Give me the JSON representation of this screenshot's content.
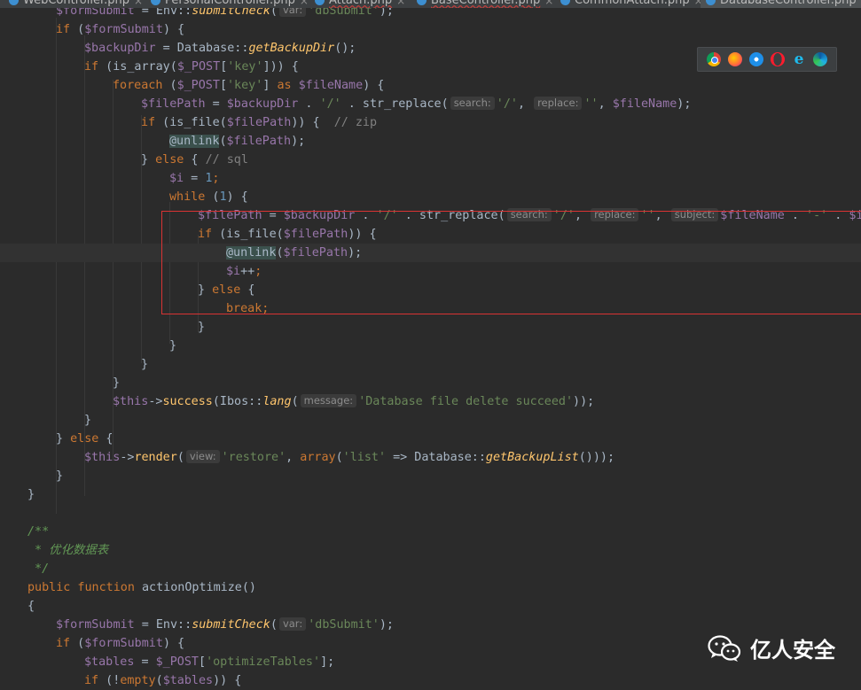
{
  "tabs": [
    {
      "label": "WebController.php"
    },
    {
      "label": "PersonalController.php"
    },
    {
      "label": "Attach.php"
    },
    {
      "label": "BaseController.php"
    },
    {
      "label": "CommonAttach.php"
    },
    {
      "label": "DatabaseController.php"
    }
  ],
  "browser_icons": [
    "chrome-icon",
    "firefox-icon",
    "safari-icon",
    "opera-icon",
    "ie-icon",
    "edge-icon"
  ],
  "colors": {
    "keyword": "#cc7832",
    "variable": "#9876aa",
    "string": "#6a8759",
    "function": "#ffc66d",
    "number": "#6897bb",
    "highlight_box": "#d93333"
  },
  "watermark": {
    "text": "亿人安全"
  },
  "code_lines": [
    {
      "indent": 1,
      "parts": [
        [
          "var",
          "$formSubmit"
        ],
        [
          "p",
          " = Env::"
        ],
        [
          "sfn",
          "submitCheck"
        ],
        [
          "p",
          "("
        ],
        [
          "hint",
          "var:"
        ],
        [
          "str",
          "'dbSubmit'"
        ],
        [
          "p",
          ");"
        ]
      ]
    },
    {
      "indent": 1,
      "parts": [
        [
          "kw",
          "if"
        ],
        [
          "p",
          " ("
        ],
        [
          "var",
          "$formSubmit"
        ],
        [
          "p",
          ") {"
        ]
      ]
    },
    {
      "indent": 2,
      "parts": [
        [
          "var",
          "$backupDir"
        ],
        [
          "p",
          " = Database::"
        ],
        [
          "sfn",
          "getBackupDir"
        ],
        [
          "p",
          "();"
        ]
      ]
    },
    {
      "indent": 2,
      "parts": [
        [
          "kw",
          "if"
        ],
        [
          "p",
          " (is_array("
        ],
        [
          "var",
          "$_POST"
        ],
        [
          "p",
          "["
        ],
        [
          "str",
          "'key'"
        ],
        [
          "p",
          "])) {"
        ]
      ]
    },
    {
      "indent": 3,
      "parts": [
        [
          "kw",
          "foreach"
        ],
        [
          "p",
          " ("
        ],
        [
          "var",
          "$_POST"
        ],
        [
          "p",
          "["
        ],
        [
          "str",
          "'key'"
        ],
        [
          "p",
          "] "
        ],
        [
          "kw",
          "as"
        ],
        [
          "p",
          " "
        ],
        [
          "var",
          "$fileName"
        ],
        [
          "p",
          ") {"
        ]
      ]
    },
    {
      "indent": 4,
      "parts": [
        [
          "var",
          "$filePath"
        ],
        [
          "p",
          " = "
        ],
        [
          "var",
          "$backupDir"
        ],
        [
          "p",
          " . "
        ],
        [
          "str",
          "'/'"
        ],
        [
          "p",
          " . str_replace("
        ],
        [
          "hint",
          "search:"
        ],
        [
          "str",
          "'/'"
        ],
        [
          "p",
          ", "
        ],
        [
          "hint",
          "replace:"
        ],
        [
          "str",
          "''"
        ],
        [
          "p",
          ", "
        ],
        [
          "var",
          "$fileName"
        ],
        [
          "p",
          ");"
        ]
      ]
    },
    {
      "indent": 4,
      "parts": [
        [
          "kw",
          "if"
        ],
        [
          "p",
          " (is_file("
        ],
        [
          "var",
          "$filePath"
        ],
        [
          "p",
          ")) {  "
        ],
        [
          "cmt",
          "// zip"
        ]
      ]
    },
    {
      "indent": 5,
      "parts": [
        [
          "hl",
          "@unlink"
        ],
        [
          "p",
          "("
        ],
        [
          "var",
          "$filePath"
        ],
        [
          "p",
          ");"
        ]
      ]
    },
    {
      "indent": 4,
      "parts": [
        [
          "p",
          "} "
        ],
        [
          "kw",
          "else"
        ],
        [
          "p",
          " { "
        ],
        [
          "cmt",
          "// sql"
        ]
      ]
    },
    {
      "indent": 5,
      "parts": [
        [
          "var",
          "$i"
        ],
        [
          "p",
          " = "
        ],
        [
          "num",
          "1"
        ],
        [
          "kw",
          ";"
        ]
      ]
    },
    {
      "indent": 5,
      "parts": [
        [
          "kw",
          "while"
        ],
        [
          "p",
          " ("
        ],
        [
          "num",
          "1"
        ],
        [
          "p",
          ") {"
        ]
      ]
    },
    {
      "indent": 6,
      "parts": [
        [
          "var",
          "$filePath"
        ],
        [
          "p",
          " = "
        ],
        [
          "var",
          "$backupDir"
        ],
        [
          "p",
          " . "
        ],
        [
          "str",
          "'/'"
        ],
        [
          "p",
          " . str_replace("
        ],
        [
          "hint",
          "search:"
        ],
        [
          "str",
          "'/'"
        ],
        [
          "p",
          ", "
        ],
        [
          "hint",
          "replace:"
        ],
        [
          "str",
          "''"
        ],
        [
          "p",
          ", "
        ],
        [
          "hint",
          "subject:"
        ],
        [
          "var",
          "$fileName"
        ],
        [
          "p",
          " . "
        ],
        [
          "str",
          "'-'"
        ],
        [
          "p",
          " . "
        ],
        [
          "var",
          "$i"
        ]
      ]
    },
    {
      "indent": 6,
      "parts": [
        [
          "kw",
          "if"
        ],
        [
          "p",
          " (is_file("
        ],
        [
          "var",
          "$filePath"
        ],
        [
          "p",
          ")) {"
        ]
      ]
    },
    {
      "indent": 7,
      "parts": [
        [
          "hl",
          "@unlink"
        ],
        [
          "p",
          "("
        ],
        [
          "var",
          "$filePath"
        ],
        [
          "p",
          ");"
        ]
      ]
    },
    {
      "indent": 7,
      "parts": [
        [
          "var",
          "$i"
        ],
        [
          "p",
          "++"
        ],
        [
          "kw",
          ";"
        ]
      ]
    },
    {
      "indent": 6,
      "parts": [
        [
          "p",
          "} "
        ],
        [
          "kw",
          "else"
        ],
        [
          "p",
          " {"
        ]
      ]
    },
    {
      "indent": 7,
      "parts": [
        [
          "kw",
          "break;"
        ]
      ]
    },
    {
      "indent": 6,
      "parts": [
        [
          "p",
          "}"
        ]
      ]
    },
    {
      "indent": 5,
      "parts": [
        [
          "p",
          "}"
        ]
      ]
    },
    {
      "indent": 4,
      "parts": [
        [
          "p",
          "}"
        ]
      ]
    },
    {
      "indent": 3,
      "parts": [
        [
          "p",
          "}"
        ]
      ]
    },
    {
      "indent": 3,
      "parts": [
        [
          "var",
          "$this"
        ],
        [
          "p",
          "->"
        ],
        [
          "fn",
          "success"
        ],
        [
          "p",
          "(Ibos::"
        ],
        [
          "sfn",
          "lang"
        ],
        [
          "p",
          "("
        ],
        [
          "hint",
          "message:"
        ],
        [
          "str",
          "'Database file delete succeed'"
        ],
        [
          "p",
          "));"
        ]
      ]
    },
    {
      "indent": 2,
      "parts": [
        [
          "p",
          "}"
        ]
      ]
    },
    {
      "indent": 1,
      "parts": [
        [
          "p",
          "} "
        ],
        [
          "kw",
          "else"
        ],
        [
          "p",
          " {"
        ]
      ]
    },
    {
      "indent": 2,
      "parts": [
        [
          "var",
          "$this"
        ],
        [
          "p",
          "->"
        ],
        [
          "fn",
          "render"
        ],
        [
          "p",
          "("
        ],
        [
          "hint",
          "view:"
        ],
        [
          "str",
          "'restore'"
        ],
        [
          "p",
          ", "
        ],
        [
          "kw",
          "array"
        ],
        [
          "p",
          "("
        ],
        [
          "str",
          "'list'"
        ],
        [
          "p",
          " => Database::"
        ],
        [
          "sfn",
          "getBackupList"
        ],
        [
          "p",
          "()));"
        ]
      ]
    },
    {
      "indent": 1,
      "parts": [
        [
          "p",
          "}"
        ]
      ]
    },
    {
      "indent": 0,
      "parts": [
        [
          "p",
          "}"
        ]
      ]
    },
    {
      "indent": 0,
      "parts": []
    },
    {
      "indent": 0,
      "parts": [
        [
          "doc",
          "/**"
        ]
      ]
    },
    {
      "indent": 0,
      "parts": [
        [
          "doc",
          " * 优化数据表"
        ]
      ]
    },
    {
      "indent": 0,
      "parts": [
        [
          "doc",
          " */"
        ]
      ]
    },
    {
      "indent": 0,
      "parts": [
        [
          "kw",
          "public function"
        ],
        [
          "p",
          " actionOptimize()"
        ]
      ]
    },
    {
      "indent": 0,
      "parts": [
        [
          "p",
          "{"
        ]
      ]
    },
    {
      "indent": 1,
      "parts": [
        [
          "var",
          "$formSubmit"
        ],
        [
          "p",
          " = Env::"
        ],
        [
          "sfn",
          "submitCheck"
        ],
        [
          "p",
          "("
        ],
        [
          "hint",
          "var:"
        ],
        [
          "str",
          "'dbSubmit'"
        ],
        [
          "p",
          ");"
        ]
      ]
    },
    {
      "indent": 1,
      "parts": [
        [
          "kw",
          "if"
        ],
        [
          "p",
          " ("
        ],
        [
          "var",
          "$formSubmit"
        ],
        [
          "p",
          ") {"
        ]
      ]
    },
    {
      "indent": 2,
      "parts": [
        [
          "var",
          "$tables"
        ],
        [
          "p",
          " = "
        ],
        [
          "var",
          "$_POST"
        ],
        [
          "p",
          "["
        ],
        [
          "str",
          "'optimizeTables'"
        ],
        [
          "p",
          "];"
        ]
      ]
    },
    {
      "indent": 2,
      "parts": [
        [
          "kw",
          "if"
        ],
        [
          "p",
          " (!"
        ],
        [
          "kw",
          "empty"
        ],
        [
          "p",
          "("
        ],
        [
          "var",
          "$tables"
        ],
        [
          "p",
          ")) {"
        ]
      ]
    }
  ]
}
